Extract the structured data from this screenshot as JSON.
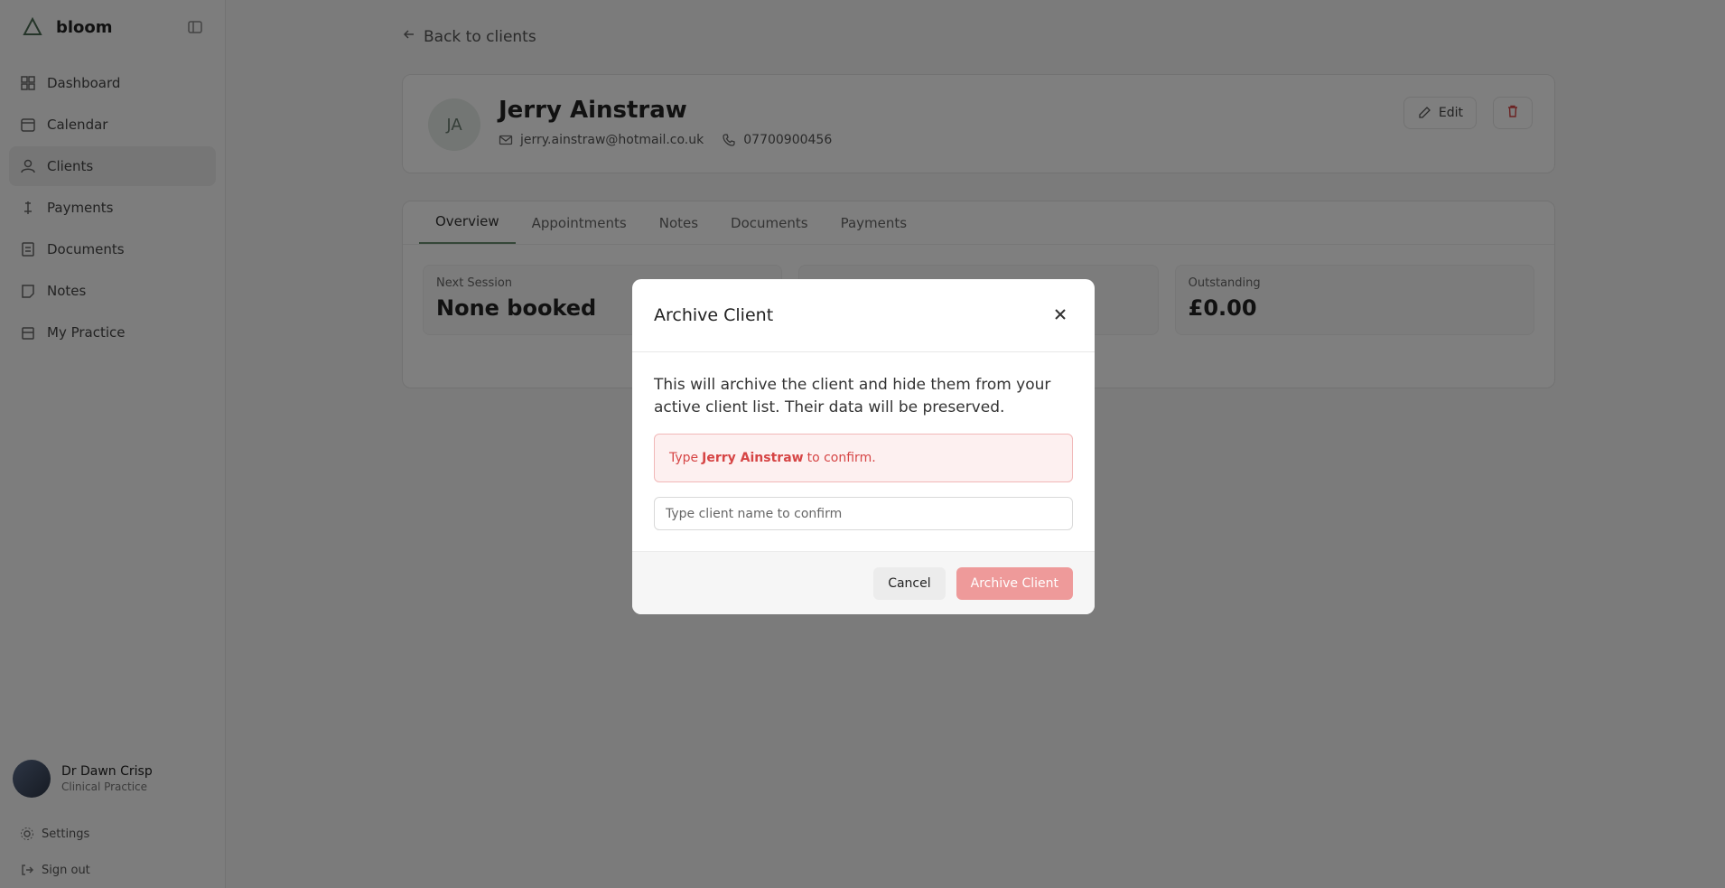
{
  "sidebar": {
    "brand": "bloom",
    "items": [
      {
        "label": "Dashboard",
        "icon": "dashboard-icon"
      },
      {
        "label": "Calendar",
        "icon": "calendar-icon"
      },
      {
        "label": "Clients",
        "icon": "clients-icon"
      },
      {
        "label": "Payments",
        "icon": "payments-icon"
      },
      {
        "label": "Documents",
        "icon": "documents-icon"
      },
      {
        "label": "Notes",
        "icon": "notes-icon"
      },
      {
        "label": "My Practice",
        "icon": "practice-icon"
      }
    ],
    "user": {
      "name": "Dr Dawn Crisp",
      "role": "Clinical Practice"
    },
    "settings": "Settings",
    "sign_out": "Sign out"
  },
  "main": {
    "back": "Back to clients",
    "client": {
      "initials": "JA",
      "name": "Jerry Ainstraw",
      "email": "jerry.ainstraw@hotmail.co.uk",
      "phone": "07700900456"
    },
    "edit": "Edit",
    "tabs": [
      "Overview",
      "Appointments",
      "Notes",
      "Documents",
      "Payments"
    ],
    "stats": [
      {
        "label": "Next Session",
        "value": "None booked"
      },
      {
        "label": "",
        "value": ""
      },
      {
        "label": "Outstanding",
        "value": "£0.00"
      }
    ]
  },
  "modal": {
    "title": "Archive Client",
    "description": "This will archive the client and hide them from your active client list. Their data will be preserved.",
    "alert_prefix": "Type",
    "alert_name": "Jerry Ainstraw",
    "alert_suffix": "to confirm.",
    "input_placeholder": "Type client name to confirm",
    "cancel": "Cancel",
    "confirm": "Archive Client"
  },
  "colors": {
    "accent": "#6b8f71",
    "danger": "#d64545",
    "danger_button": "#ee9a9a"
  }
}
